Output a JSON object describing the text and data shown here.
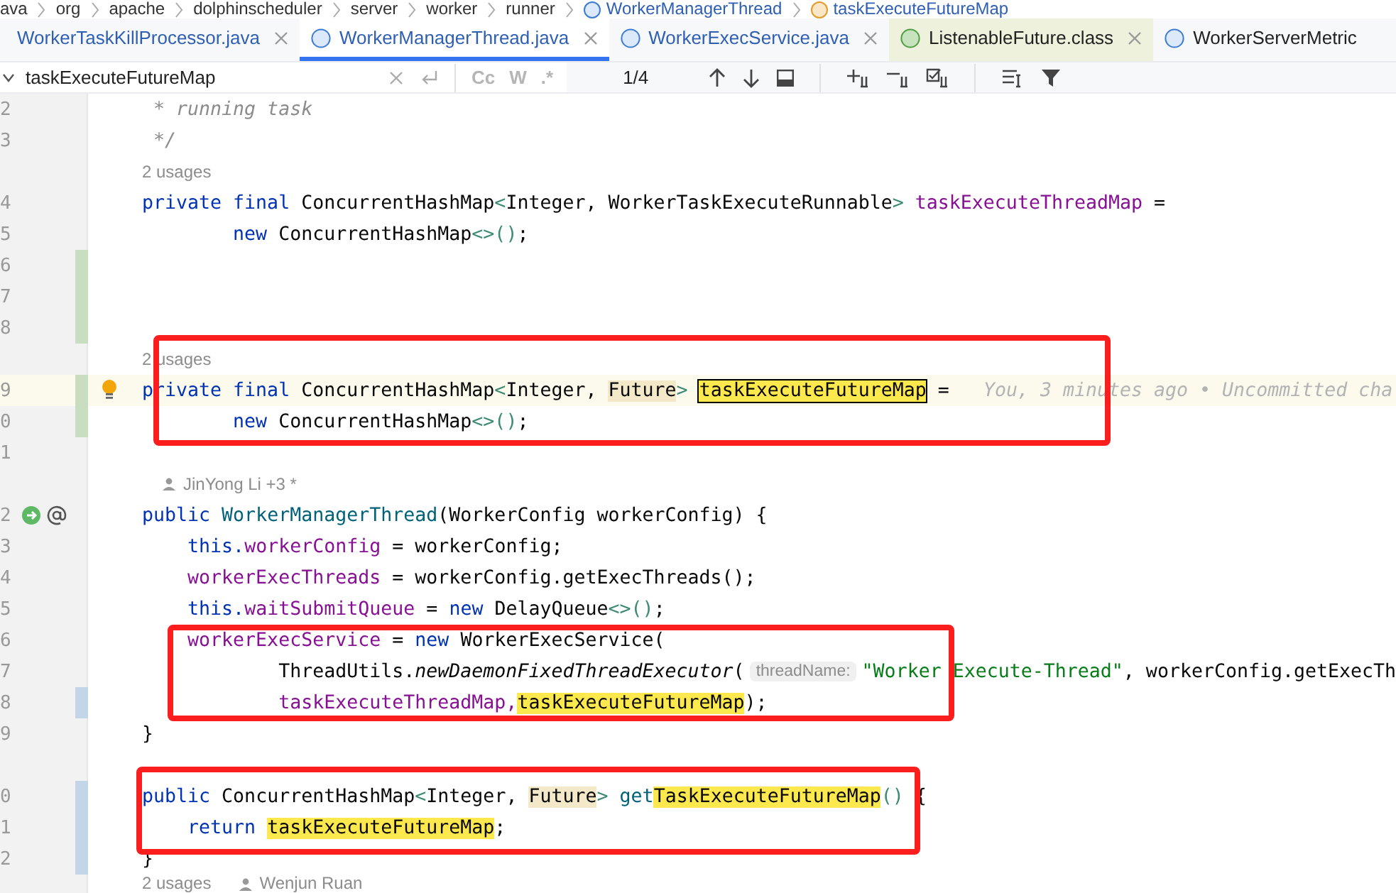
{
  "breadcrumbs": [
    {
      "label": "ava",
      "kind": "package"
    },
    {
      "label": "org",
      "kind": "package"
    },
    {
      "label": "apache",
      "kind": "package"
    },
    {
      "label": "dolphinscheduler",
      "kind": "package"
    },
    {
      "label": "server",
      "kind": "package"
    },
    {
      "label": "worker",
      "kind": "package"
    },
    {
      "label": "runner",
      "kind": "package"
    },
    {
      "label": "WorkerManagerThread",
      "kind": "class"
    },
    {
      "label": "taskExecuteFutureMap",
      "kind": "field"
    }
  ],
  "tabs": [
    {
      "label": "WorkerTaskKillProcessor.java",
      "kind": "plain",
      "selected": false,
      "vcs_modified": true,
      "closable": true
    },
    {
      "label": "WorkerManagerThread.java",
      "kind": "class",
      "selected": true,
      "vcs_modified": true,
      "closable": true
    },
    {
      "label": "WorkerExecService.java",
      "kind": "class",
      "selected": false,
      "vcs_modified": true,
      "closable": true
    },
    {
      "label": "ListenableFuture.class",
      "kind": "interface",
      "selected": false,
      "vcs_modified": false,
      "closable": true
    },
    {
      "label": "WorkerServerMetric",
      "kind": "class",
      "selected": false,
      "vcs_modified": false,
      "closable": false
    }
  ],
  "search": {
    "value": "taskExecuteFutureMap",
    "toggles": [
      {
        "label": "Cc",
        "on": false
      },
      {
        "label": "W",
        "on": false
      },
      {
        "label": ".*",
        "on": false
      }
    ],
    "count": "1/4"
  },
  "editor": {
    "rows": [
      {
        "kind": "code",
        "number": "2",
        "tokens": [
          {
            "text": " * running task",
            "kind": "doc"
          }
        ]
      },
      {
        "kind": "code",
        "number": "3",
        "tokens": [
          {
            "text": " */",
            "kind": "doc"
          }
        ]
      },
      {
        "kind": "inlay",
        "items": [
          {
            "text": "2 usages",
            "person": false
          }
        ]
      },
      {
        "kind": "code",
        "number": "4",
        "tokens": [
          {
            "text": "private final ",
            "kind": "kw"
          },
          {
            "text": "ConcurrentHashMap",
            "kind": "plain"
          },
          {
            "text": "<",
            "kind": "gen"
          },
          {
            "text": "Integer, WorkerTaskExecuteRunnable",
            "kind": "plain"
          },
          {
            "text": "> ",
            "kind": "gen"
          },
          {
            "text": "taskExecuteThreadMap",
            "kind": "field"
          },
          {
            "text": " =",
            "kind": "plain"
          }
        ]
      },
      {
        "kind": "code",
        "number": "5",
        "tokens": [
          {
            "text": "        new ",
            "kind": "kw"
          },
          {
            "text": "ConcurrentHashMap",
            "kind": "plain"
          },
          {
            "text": "<>()",
            "kind": "gen"
          },
          {
            "text": ";",
            "kind": "plain"
          }
        ]
      },
      {
        "kind": "code",
        "number": "6",
        "added": true,
        "tokens": []
      },
      {
        "kind": "code",
        "number": "7",
        "added": true,
        "tokens": []
      },
      {
        "kind": "code",
        "number": "8",
        "added": true,
        "tokens": []
      },
      {
        "kind": "inlay",
        "items": [
          {
            "text": "2 usages",
            "person": false
          }
        ]
      },
      {
        "kind": "code",
        "number": "9",
        "added": true,
        "current": true,
        "lightbulb": true,
        "tokens": [
          {
            "text": "private final ",
            "kind": "kw"
          },
          {
            "text": "ConcurrentHashMap",
            "kind": "plain"
          },
          {
            "text": "<",
            "kind": "gen"
          },
          {
            "text": "Integer, ",
            "kind": "plain"
          },
          {
            "text": "Future",
            "kind": "plain",
            "usage_highlight": true
          },
          {
            "text": "> ",
            "kind": "gen"
          },
          {
            "text": "taskExecuteFutureMap",
            "kind": "field",
            "search_match": true,
            "at_caret": true
          },
          {
            "text": " =",
            "kind": "plain"
          },
          {
            "text": "You, 3 minutes ago • Uncommitted cha",
            "kind": "blame"
          }
        ]
      },
      {
        "kind": "code",
        "number": "0",
        "added": true,
        "tokens": [
          {
            "text": "        new ",
            "kind": "kw"
          },
          {
            "text": "ConcurrentHashMap",
            "kind": "plain"
          },
          {
            "text": "<>()",
            "kind": "gen"
          },
          {
            "text": ";",
            "kind": "plain"
          }
        ]
      },
      {
        "kind": "code",
        "number": "1",
        "tokens": []
      },
      {
        "kind": "inlay",
        "items": [
          {
            "text": "JinYong Li +3 *",
            "person": true
          }
        ]
      },
      {
        "kind": "code",
        "number": "2",
        "run_icons": true,
        "tokens": [
          {
            "text": "public ",
            "kind": "kw"
          },
          {
            "text": "WorkerManagerThread",
            "kind": "decl"
          },
          {
            "text": "(WorkerConfig workerConfig) {",
            "kind": "plain"
          }
        ]
      },
      {
        "kind": "code",
        "number": "3",
        "tokens": [
          {
            "text": "    this.",
            "kind": "kw"
          },
          {
            "text": "workerConfig",
            "kind": "field"
          },
          {
            "text": " = workerConfig;",
            "kind": "plain"
          }
        ]
      },
      {
        "kind": "code",
        "number": "4",
        "tokens": [
          {
            "text": "    workerExecThreads",
            "kind": "field"
          },
          {
            "text": " = workerConfig.getExecThreads();",
            "kind": "plain"
          }
        ]
      },
      {
        "kind": "code",
        "number": "5",
        "tokens": [
          {
            "text": "    this.",
            "kind": "kw"
          },
          {
            "text": "waitSubmitQueue",
            "kind": "field"
          },
          {
            "text": " = ",
            "kind": "plain"
          },
          {
            "text": "new ",
            "kind": "kw"
          },
          {
            "text": "DelayQueue",
            "kind": "plain"
          },
          {
            "text": "<>()",
            "kind": "gen"
          },
          {
            "text": ";",
            "kind": "plain"
          }
        ]
      },
      {
        "kind": "code",
        "number": "6",
        "tokens": [
          {
            "text": "    workerExecService",
            "kind": "field"
          },
          {
            "text": " = ",
            "kind": "plain"
          },
          {
            "text": "new ",
            "kind": "kw"
          },
          {
            "text": "WorkerExecService(",
            "kind": "plain"
          }
        ]
      },
      {
        "kind": "code",
        "number": "7",
        "tokens": [
          {
            "text": "            ThreadUtils.",
            "kind": "plain"
          },
          {
            "text": "newDaemonFixedThreadExecutor",
            "kind": "static"
          },
          {
            "text": "(",
            "kind": "plain"
          },
          {
            "text": "threadName:",
            "kind": "hint"
          },
          {
            "text": "\"Worker Execute-Thread\"",
            "kind": "str"
          },
          {
            "text": ", workerConfig.getExecTh",
            "kind": "plain"
          }
        ]
      },
      {
        "kind": "code",
        "number": "8",
        "modified": true,
        "tokens": [
          {
            "text": "            taskExecuteThreadMap,",
            "kind": "field"
          },
          {
            "text": "taskExecuteFutureMap",
            "kind": "field",
            "search_match": true
          },
          {
            "text": ");",
            "kind": "plain"
          }
        ]
      },
      {
        "kind": "code",
        "number": "9",
        "tokens": [
          {
            "text": "}",
            "kind": "plain"
          }
        ]
      },
      {
        "kind": "inlay",
        "items": []
      },
      {
        "kind": "code",
        "number": "0",
        "modified": true,
        "tokens": [
          {
            "text": "public ",
            "kind": "kw"
          },
          {
            "text": "ConcurrentHashMap",
            "kind": "plain"
          },
          {
            "text": "<",
            "kind": "gen"
          },
          {
            "text": "Integer, ",
            "kind": "plain"
          },
          {
            "text": "Future",
            "kind": "plain",
            "usage_highlight": true
          },
          {
            "text": "> ",
            "kind": "gen"
          },
          {
            "text": "get",
            "kind": "decl"
          },
          {
            "text": "TaskExecuteFutureMap",
            "kind": "decl",
            "search_match": true
          },
          {
            "text": "()",
            "kind": "gen"
          },
          {
            "text": " {",
            "kind": "plain"
          }
        ]
      },
      {
        "kind": "code",
        "number": "1",
        "modified": true,
        "tokens": [
          {
            "text": "    return ",
            "kind": "kw"
          },
          {
            "text": "taskExecuteFutureMap",
            "kind": "field",
            "search_match": true
          },
          {
            "text": ";",
            "kind": "plain"
          }
        ]
      },
      {
        "kind": "code",
        "number": "2",
        "modified": true,
        "tokens": [
          {
            "text": "}",
            "kind": "plain"
          }
        ]
      },
      {
        "kind": "inlay",
        "items": [
          {
            "text": "2 usages",
            "person": false
          },
          {
            "text": "Wenjun Ruan",
            "person": true
          }
        ]
      }
    ]
  },
  "annotation_boxes": [
    {
      "kind": "red-rectangle"
    },
    {
      "kind": "red-rectangle"
    },
    {
      "kind": "red-rectangle"
    }
  ]
}
